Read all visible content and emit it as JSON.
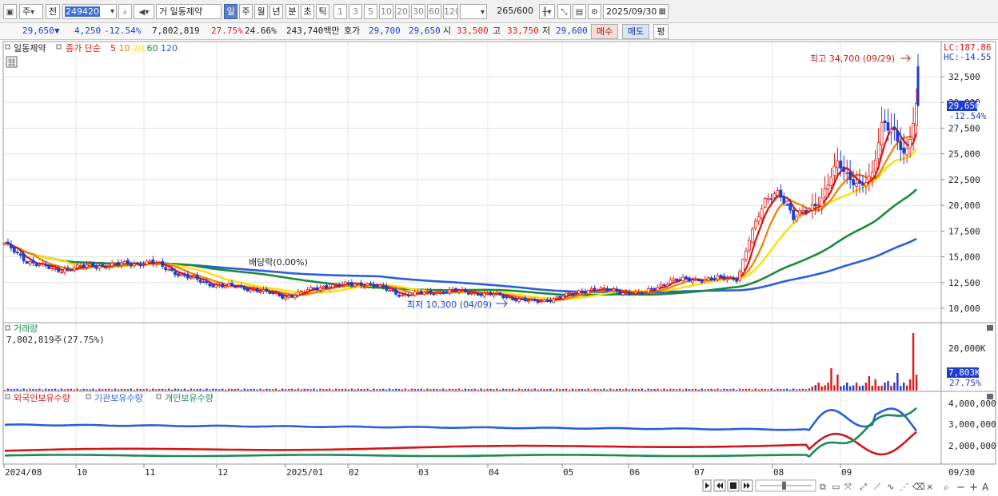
{
  "toolbar": {
    "market": "주",
    "prev_label": "전",
    "stock_code": "249420",
    "exchange_prefix": "거",
    "stock_name": "일동제약",
    "period_tabs": [
      "일",
      "주",
      "월",
      "년",
      "분",
      "초",
      "틱"
    ],
    "active_period": "일",
    "interval_buttons": [
      "1",
      "3",
      "5",
      "10",
      "20",
      "30",
      "60",
      "120"
    ],
    "bar_count": "265",
    "bar_total": "/600",
    "date": "2025/09/30"
  },
  "quote": {
    "price": "29,650",
    "direction_icon": "down-triangle",
    "change": "4,250",
    "change_pct": "-12.54%",
    "volume": "7,802,819",
    "volume_ratio": "27.75%",
    "turnover": "24.66%",
    "amount": "243,740백만",
    "bid_label": "호가",
    "ask": "29,700",
    "bid": "29,650",
    "open_label": "시",
    "open": "33,500",
    "high_label": "고",
    "high": "33,750",
    "low_label": "저",
    "low": "29,600",
    "buy_label": "매수",
    "sell_label": "매도",
    "avg_label": "평"
  },
  "price_panel": {
    "stock_label": "일동제약",
    "close_label": "종가 단순",
    "ma_periods": [
      "5",
      "10",
      "20",
      "60",
      "120"
    ],
    "ma_colors": [
      "#e01010",
      "#f08000",
      "#ffe000",
      "#1c8a3a",
      "#2a5fd8"
    ],
    "lc_label": "LC:187.86",
    "hc_label": "HC:-14.55",
    "high_annotation": "최고 34,700 (09/29)",
    "low_annotation": "최저 10,300 (04/09)",
    "dividend_annotation": "배당락(0.00%)",
    "y_ticks": [
      "32,500",
      "30,000",
      "27,500",
      "25,000",
      "22,500",
      "20,000",
      "17,500",
      "15,000",
      "12,500",
      "10,000"
    ],
    "current_price_tag": "29,650",
    "current_pct_tag": "-12.54%"
  },
  "volume_panel": {
    "title": "거래량",
    "value_label": "7,802,819주(27.75%)",
    "y_tick": "20,000K",
    "current_tag": "7,803K",
    "current_pct": "27.75%"
  },
  "holding_panel": {
    "legends": [
      "외국인보유수량",
      "기관보유수량",
      "개인보유수량"
    ],
    "legend_colors": [
      "#d01818",
      "#2a5fd8",
      "#1c8a55"
    ],
    "y_ticks": [
      "4,000,000",
      "3,000,000",
      "2,000,000"
    ]
  },
  "x_axis": {
    "labels": [
      "2024/08",
      "10",
      "11",
      "12",
      "2025/01",
      "02",
      "03",
      "04",
      "05",
      "06",
      "07",
      "08",
      "09"
    ],
    "right_label": "09/30"
  },
  "chart_data": {
    "type": "candlestick",
    "price_high": 34700,
    "price_high_date": "09/29",
    "price_low": 10300,
    "price_low_date": "04/09",
    "last_close": 29650,
    "series": [
      {
        "name": "5",
        "type": "line"
      },
      {
        "name": "10",
        "type": "line"
      },
      {
        "name": "20",
        "type": "line"
      },
      {
        "name": "60",
        "type": "line"
      },
      {
        "name": "120",
        "type": "line"
      }
    ],
    "ylim": [
      9000,
      35500
    ]
  }
}
